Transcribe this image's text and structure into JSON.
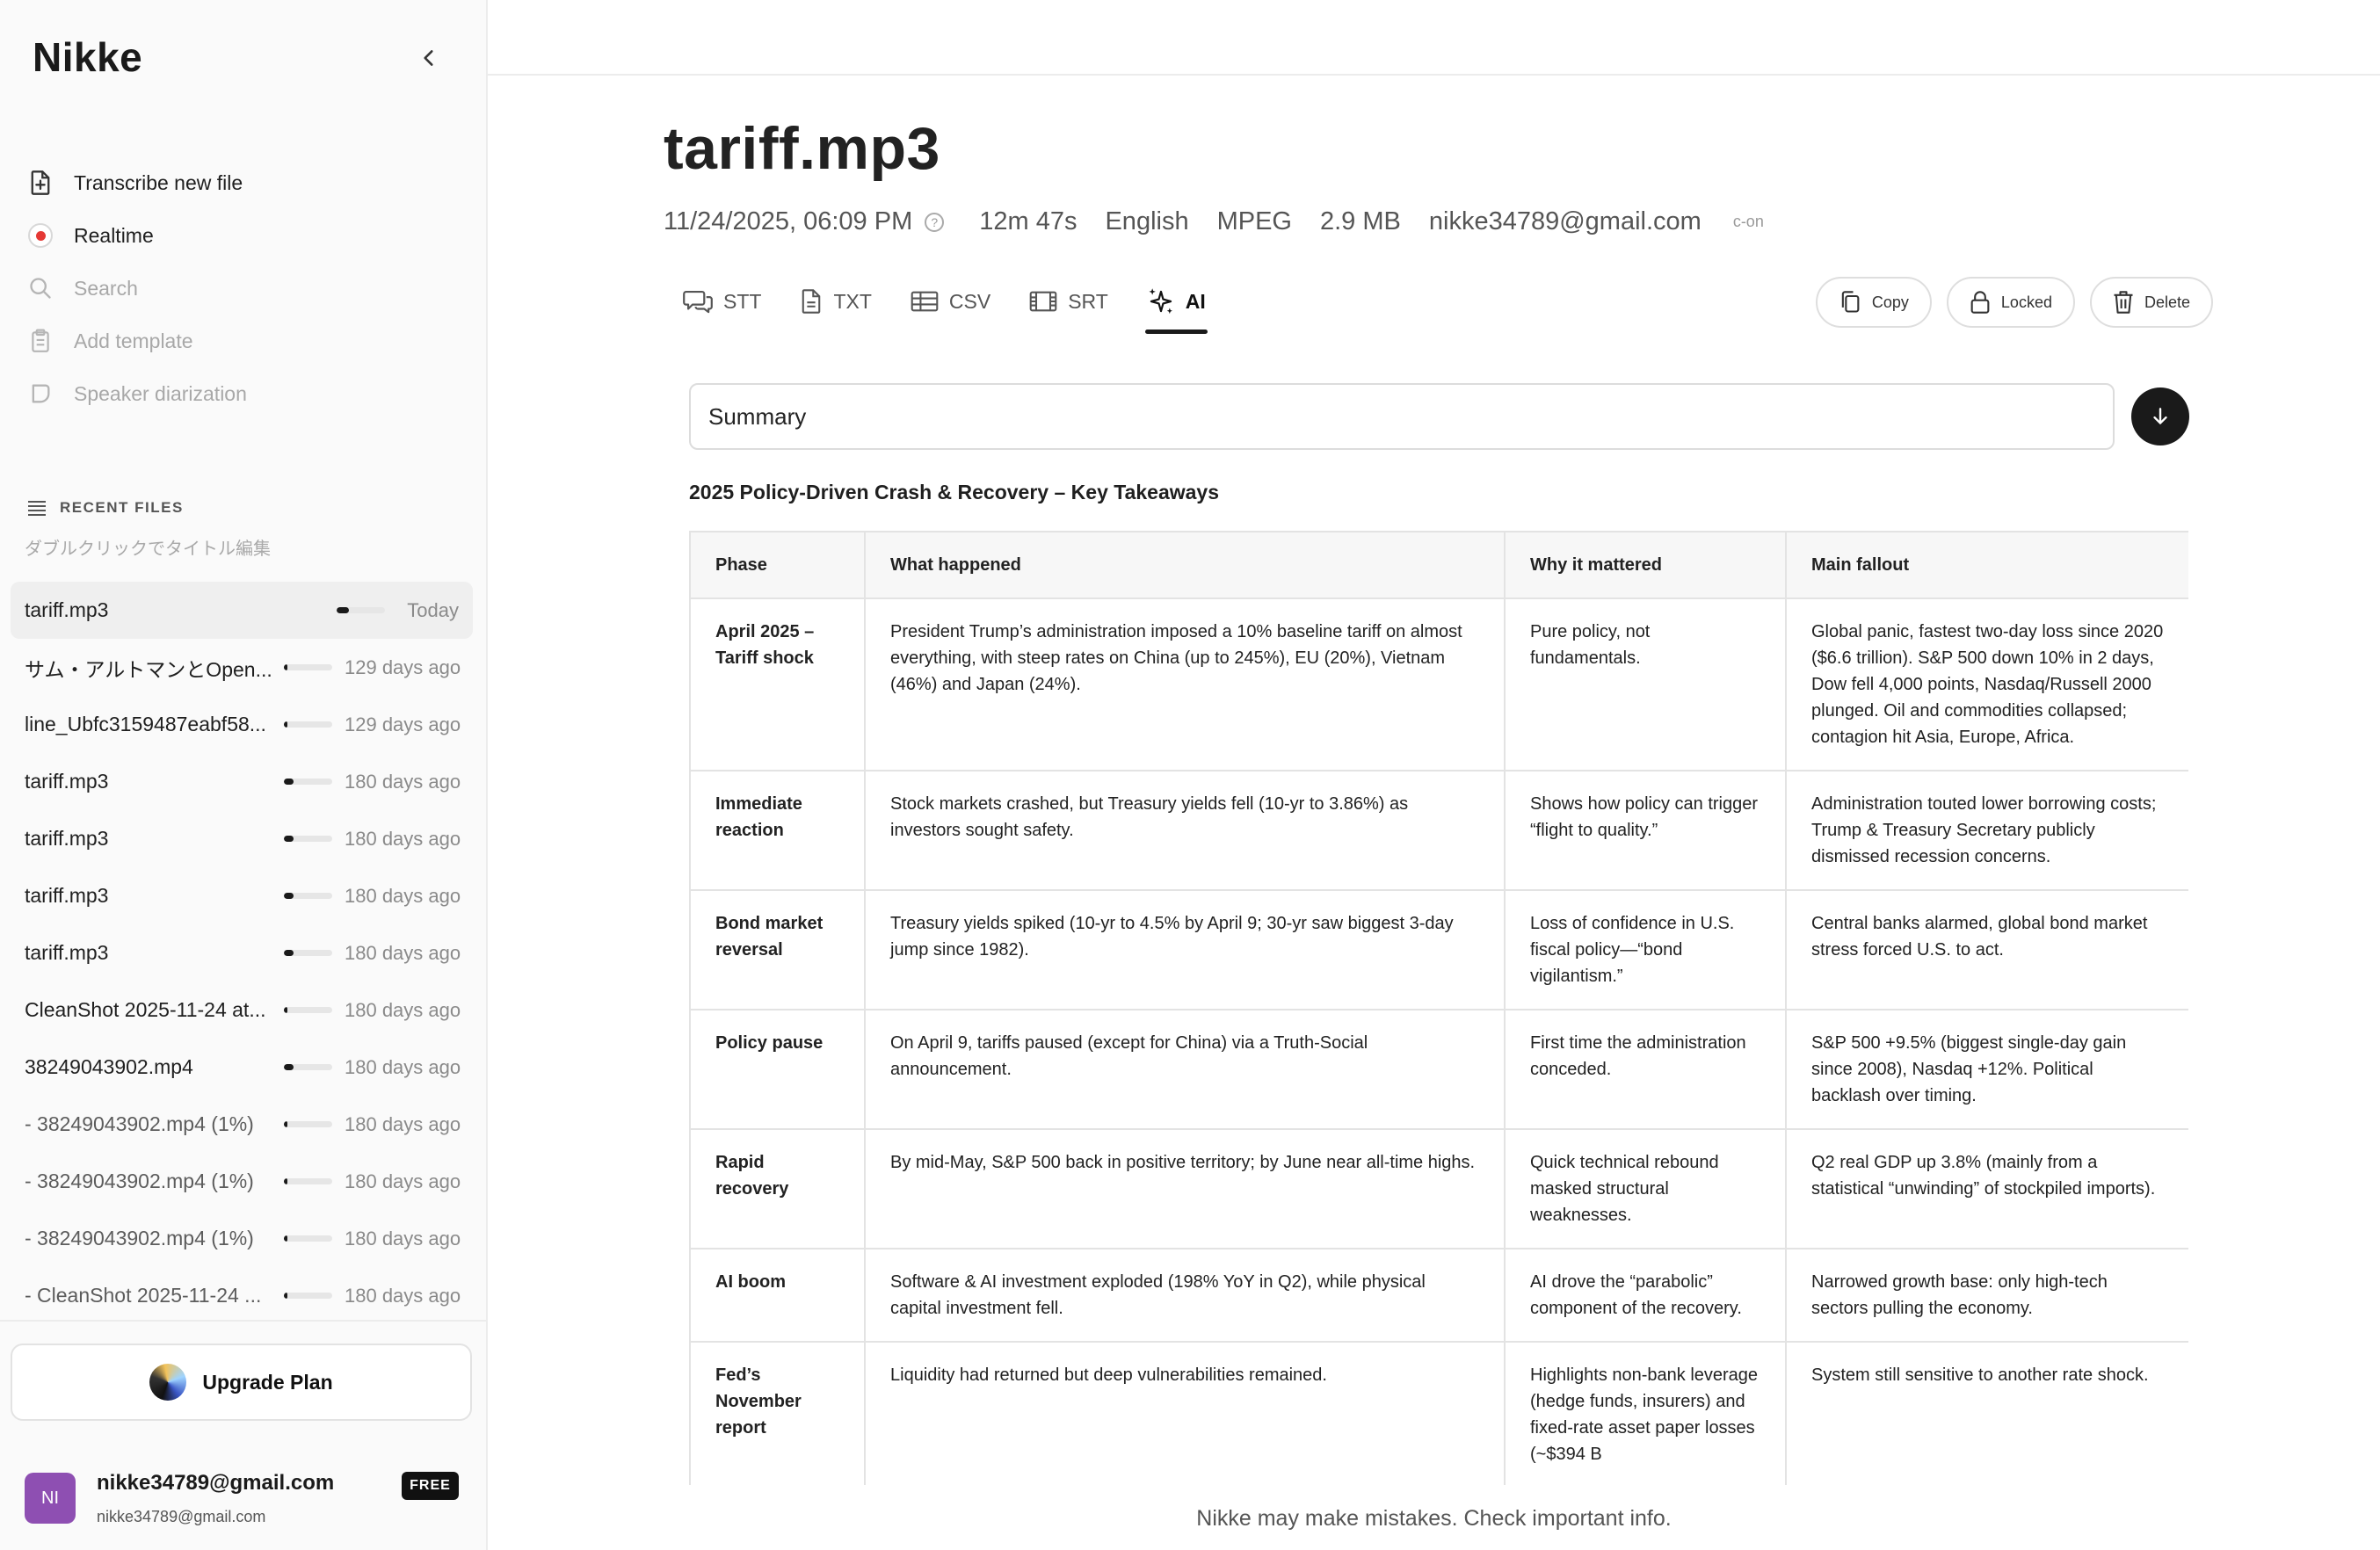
{
  "app": {
    "name": "Nikke"
  },
  "sidebar": {
    "nav": [
      {
        "label": "Transcribe new file",
        "icon": "file-plus-icon",
        "muted": false
      },
      {
        "label": "Realtime",
        "icon": "record-icon",
        "muted": false
      },
      {
        "label": "Search",
        "icon": "search-icon",
        "muted": true
      },
      {
        "label": "Add template",
        "icon": "template-icon",
        "muted": true
      },
      {
        "label": "Speaker diarization",
        "icon": "speaker-icon",
        "muted": true
      }
    ],
    "recent_header": "RECENT FILES",
    "recent_hint": "ダブルクリックでタイトル編集",
    "files": [
      {
        "name": "tariff.mp3",
        "date": "Today",
        "progress": 0.25,
        "active": true,
        "dim": false
      },
      {
        "name": "サム・アルトマンとOpen...",
        "date": "129 days ago",
        "progress": 0.08,
        "active": false,
        "dim": false
      },
      {
        "name": "line_Ubfc3159487eabf58...",
        "date": "129 days ago",
        "progress": 0.08,
        "active": false,
        "dim": false
      },
      {
        "name": "tariff.mp3",
        "date": "180 days ago",
        "progress": 0.2,
        "active": false,
        "dim": false
      },
      {
        "name": "tariff.mp3",
        "date": "180 days ago",
        "progress": 0.2,
        "active": false,
        "dim": false
      },
      {
        "name": "tariff.mp3",
        "date": "180 days ago",
        "progress": 0.2,
        "active": false,
        "dim": false
      },
      {
        "name": "tariff.mp3",
        "date": "180 days ago",
        "progress": 0.2,
        "active": false,
        "dim": false
      },
      {
        "name": "CleanShot 2025-11-24 at...",
        "date": "180 days ago",
        "progress": 0.08,
        "active": false,
        "dim": false
      },
      {
        "name": "38249043902.mp4",
        "date": "180 days ago",
        "progress": 0.2,
        "active": false,
        "dim": false
      },
      {
        "name": "- 38249043902.mp4 (1%)",
        "date": "180 days ago",
        "progress": 0.08,
        "active": false,
        "dim": true
      },
      {
        "name": "- 38249043902.mp4 (1%)",
        "date": "180 days ago",
        "progress": 0.08,
        "active": false,
        "dim": true
      },
      {
        "name": "- 38249043902.mp4 (1%)",
        "date": "180 days ago",
        "progress": 0.08,
        "active": false,
        "dim": true
      },
      {
        "name": "- CleanShot 2025-11-24 ...",
        "date": "180 days ago",
        "progress": 0.08,
        "active": false,
        "dim": true
      }
    ],
    "upgrade_label": "Upgrade Plan",
    "account": {
      "initials": "NI",
      "email": "nikke34789@gmail.com",
      "sub_email": "nikke34789@gmail.com",
      "plan": "FREE",
      "avatar_color": "#8e4fb2"
    }
  },
  "main": {
    "title": "tariff.mp3",
    "meta": {
      "datetime": "11/24/2025, 06:09 PM",
      "help": "?",
      "duration": "12m 47s",
      "language": "English",
      "format": "MPEG",
      "size": "2.9 MB",
      "owner": "nikke34789@gmail.com",
      "tag": "c-on"
    },
    "tabs": [
      {
        "label": "STT",
        "icon": "chat-icon",
        "active": false
      },
      {
        "label": "TXT",
        "icon": "document-icon",
        "active": false
      },
      {
        "label": "CSV",
        "icon": "table-icon",
        "active": false
      },
      {
        "label": "SRT",
        "icon": "film-icon",
        "active": false
      },
      {
        "label": "AI",
        "icon": "sparkle-icon",
        "active": true
      }
    ],
    "actions": {
      "copy": "Copy",
      "locked": "Locked",
      "delete": "Delete"
    },
    "summary_select": "Summary",
    "section_title": "2025 Policy-Driven Crash & Recovery – Key Takeaways",
    "table": {
      "headers": [
        "Phase",
        "What happened",
        "Why it mattered",
        "Main fallout"
      ],
      "rows": [
        [
          "April 2025 – Tariff shock",
          "President Trump’s administration imposed a 10% baseline tariff on almost everything, with steep rates on China (up to 245%), EU (20%), Vietnam (46%) and Japan (24%).",
          "Pure policy, not fundamentals.",
          "Global panic, fastest two-day loss since 2020 ($6.6 trillion). S&P 500 down 10% in 2 days, Dow fell 4,000 points, Nasdaq/Russell 2000 plunged. Oil and commodities collapsed; contagion hit Asia, Europe, Africa."
        ],
        [
          "Immediate reaction",
          "Stock markets crashed, but Treasury yields fell (10-yr to 3.86%) as investors sought safety.",
          "Shows how policy can trigger “flight to quality.”",
          "Administration touted lower borrowing costs; Trump & Treasury Secretary publicly dismissed recession concerns."
        ],
        [
          "Bond market reversal",
          "Treasury yields spiked (10-yr to 4.5% by April 9; 30-yr saw biggest 3-day jump since 1982).",
          "Loss of confidence in U.S. fiscal policy—“bond vigilantism.”",
          "Central banks alarmed, global bond market stress forced U.S. to act."
        ],
        [
          "Policy pause",
          "On April 9, tariffs paused (except for China) via a Truth-Social announcement.",
          "First time the administration conceded.",
          "S&P 500 +9.5% (biggest single-day gain since 2008), Nasdaq +12%. Political backlash over timing."
        ],
        [
          "Rapid recovery",
          "By mid-May, S&P 500 back in positive territory; by June near all-time highs.",
          "Quick technical rebound masked structural weaknesses.",
          "Q2 real GDP up 3.8% (mainly from a statistical “unwinding” of stockpiled imports)."
        ],
        [
          "AI boom",
          "Software & AI investment exploded (198% YoY in Q2), while physical capital investment fell.",
          "AI drove the “parabolic” component of the recovery.",
          "Narrowed growth base: only high-tech sectors pulling the economy."
        ],
        [
          "Fed’s November report",
          "Liquidity had returned but deep vulnerabilities remained.",
          "Highlights non-bank leverage (hedge funds, insurers) and fixed-rate asset paper losses (~$394 B",
          "System still sensitive to another rate shock."
        ]
      ]
    },
    "footer_note": "Nikke may make mistakes. Check important info."
  }
}
